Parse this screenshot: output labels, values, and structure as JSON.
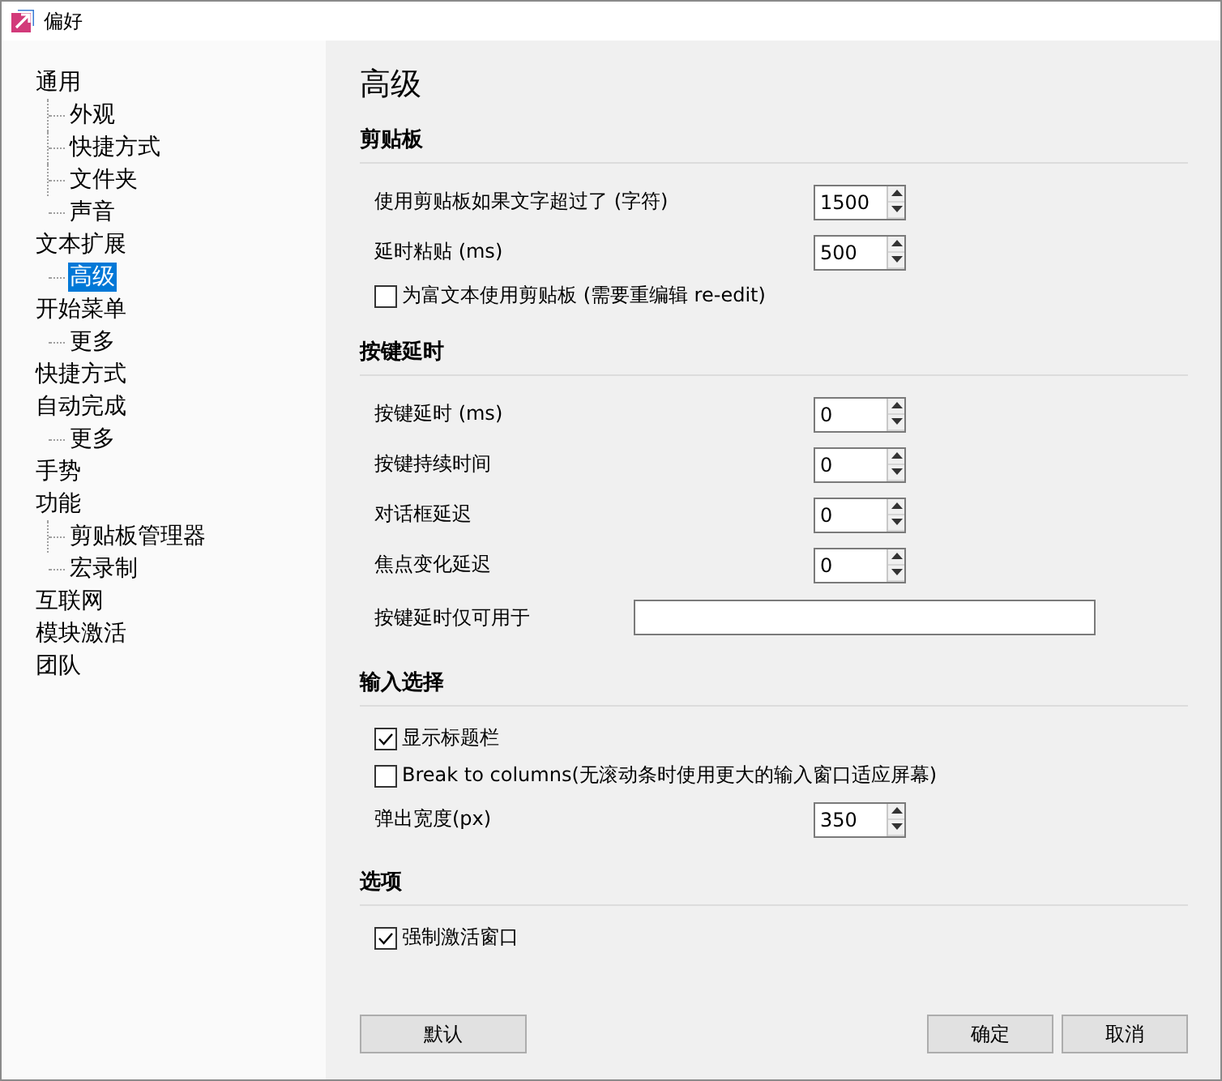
{
  "window": {
    "title": "偏好"
  },
  "sidebar": {
    "items": [
      {
        "label": "通用",
        "selected": false,
        "children": [
          {
            "label": "外观",
            "selected": false
          },
          {
            "label": "快捷方式",
            "selected": false
          },
          {
            "label": "文件夹",
            "selected": false
          },
          {
            "label": "声音",
            "selected": false
          }
        ]
      },
      {
        "label": "文本扩展",
        "selected": false,
        "children": [
          {
            "label": "高级",
            "selected": true
          }
        ]
      },
      {
        "label": "开始菜单",
        "selected": false,
        "children": [
          {
            "label": "更多",
            "selected": false
          }
        ]
      },
      {
        "label": "快捷方式",
        "selected": false
      },
      {
        "label": "自动完成",
        "selected": false,
        "children": [
          {
            "label": "更多",
            "selected": false
          }
        ]
      },
      {
        "label": "手势",
        "selected": false
      },
      {
        "label": "功能",
        "selected": false,
        "children": [
          {
            "label": "剪贴板管理器",
            "selected": false
          },
          {
            "label": "宏录制",
            "selected": false
          }
        ]
      },
      {
        "label": "互联网",
        "selected": false
      },
      {
        "label": "模块激活",
        "selected": false
      },
      {
        "label": "团队",
        "selected": false
      }
    ]
  },
  "page": {
    "title": "高级",
    "sections": [
      {
        "title": "剪贴板",
        "rows": [
          {
            "kind": "spin",
            "label": "使用剪贴板如果文字超过了 (字符)",
            "value": "1500"
          },
          {
            "kind": "spin",
            "label": "延时粘贴 (ms)",
            "value": "500"
          },
          {
            "kind": "checkbox",
            "label": "为富文本使用剪贴板 (需要重编辑 re-edit)",
            "checked": false
          }
        ]
      },
      {
        "title": "按键延时",
        "rows": [
          {
            "kind": "spin",
            "label": "按键延时 (ms)",
            "value": "0"
          },
          {
            "kind": "spin",
            "label": "按键持续时间",
            "value": "0"
          },
          {
            "kind": "spin",
            "label": "对话框延迟",
            "value": "0"
          },
          {
            "kind": "spin",
            "label": "焦点变化延迟",
            "value": "0"
          },
          {
            "kind": "text",
            "label": "按键延时仅可用于"
          }
        ]
      },
      {
        "title": "输入选择",
        "rows": [
          {
            "kind": "checkbox",
            "label": "显示标题栏",
            "checked": true
          },
          {
            "kind": "checkbox",
            "label": "Break to columns(无滚动条时使用更大的输入窗口适应屏幕)",
            "checked": false
          },
          {
            "kind": "spin",
            "label": "弹出宽度(px)",
            "value": "350"
          }
        ]
      },
      {
        "title": "选项",
        "rows": [
          {
            "kind": "checkbox",
            "label": "强制激活窗口",
            "checked": true
          }
        ]
      }
    ]
  },
  "buttons": {
    "left": [
      "默认"
    ],
    "right": [
      "确定",
      "取消"
    ]
  }
}
